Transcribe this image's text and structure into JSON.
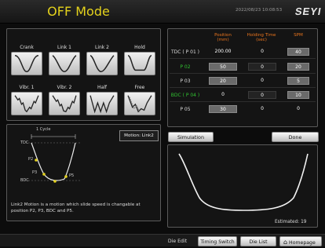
{
  "header": {
    "title": "OFF Mode",
    "datetime": "2022/08/23 10:08:53",
    "logo": "SEYI"
  },
  "motions": {
    "row1": [
      "Crank",
      "Link 1",
      "Link 2",
      "Hold"
    ],
    "row2": [
      "Vibr. 1",
      "Vibr. 2",
      "Half",
      "Free"
    ]
  },
  "diagram": {
    "motion_label": "Motion: Link2",
    "cycle_label": "1 Cycle",
    "points": {
      "tdc": "TDC",
      "p2": "P2",
      "p3": "P3",
      "bdc": "BDC",
      "p5": "P5"
    },
    "description": "Link2 Motion is a motion which slide speed is changable at position P2, P3, BDC and P5."
  },
  "table": {
    "headers": {
      "position": "Position\n(mm)",
      "holding": "Holding Time\n(sec)",
      "spm": "SPM"
    },
    "rows": [
      {
        "label": "TDC ( P 01 )",
        "position": "200.00",
        "holding": "0",
        "spm": "40"
      },
      {
        "label": "P 02",
        "position": "50",
        "holding": "0",
        "spm": "20"
      },
      {
        "label": "P 03",
        "position": "20",
        "holding": "0",
        "spm": "5"
      },
      {
        "label": "BDC ( P 04 )",
        "position": "0",
        "holding": "0",
        "spm": "10"
      },
      {
        "label": "P 05",
        "position": "30",
        "holding": "0",
        "spm": "0"
      }
    ]
  },
  "actions": {
    "simulation": "Simulation",
    "done": "Done"
  },
  "graph": {
    "estimated": "Estimated: 19"
  },
  "footer": {
    "die_edit": "Die Edit",
    "timing_switch": "Timing Switch",
    "die_list": "Die List",
    "homepage": "Homepage"
  },
  "colors": {
    "title": "#e4d21c",
    "header_text": "#e8741e",
    "green_label": "#31c331",
    "panel_border": "#5a5a5a"
  }
}
